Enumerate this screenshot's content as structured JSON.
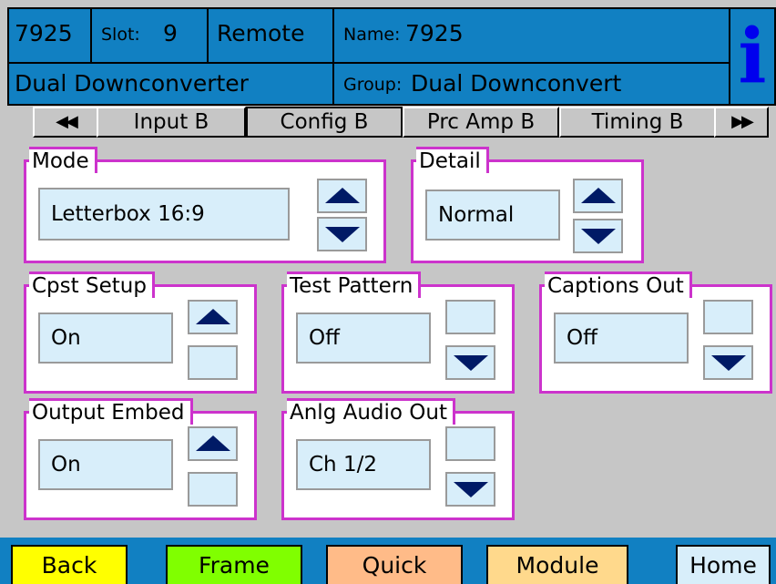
{
  "header": {
    "module_id": "7925",
    "slot_label": "Slot:",
    "slot_value": "9",
    "remote_label": "Remote",
    "name_label": "Name:",
    "name_value": "7925",
    "description": "Dual Downconverter",
    "group_label": "Group:",
    "group_value": "Dual Downconvert",
    "info_icon": "i"
  },
  "tabs": {
    "prev_label": "◀◀",
    "next_label": "▶▶",
    "items": [
      {
        "label": "Input B"
      },
      {
        "label": "Config B"
      },
      {
        "label": "Prc Amp B"
      },
      {
        "label": "Timing B"
      }
    ]
  },
  "panels": {
    "mode": {
      "title": "Mode",
      "value": "Letterbox 16:9"
    },
    "detail": {
      "title": "Detail",
      "value": "Normal"
    },
    "cpst_setup": {
      "title": "Cpst Setup",
      "value": "On"
    },
    "test_pattern": {
      "title": "Test Pattern",
      "value": "Off"
    },
    "captions_out": {
      "title": "Captions Out",
      "value": "Off"
    },
    "output_embed": {
      "title": "Output Embed",
      "value": "On"
    },
    "anlg_audio_out": {
      "title": "Anlg Audio Out",
      "value": "Ch 1/2"
    }
  },
  "icons": {
    "up": "arrow-up-icon",
    "down": "arrow-down-icon",
    "info": "info-icon"
  },
  "colors": {
    "header_bg": "#1180c2",
    "panel_border": "#cc33cc",
    "value_bg": "#d8eefa",
    "arrow": "#001a66",
    "back_btn": "#ffff00",
    "frame_btn": "#80ff00",
    "quick_btn": "#ffbb88",
    "module_btn": "#ffd98c",
    "home_btn": "#d8eefa"
  },
  "bottom": {
    "back": "Back",
    "frame": "Frame",
    "quick": "Quick",
    "module": "Module",
    "home": "Home"
  }
}
